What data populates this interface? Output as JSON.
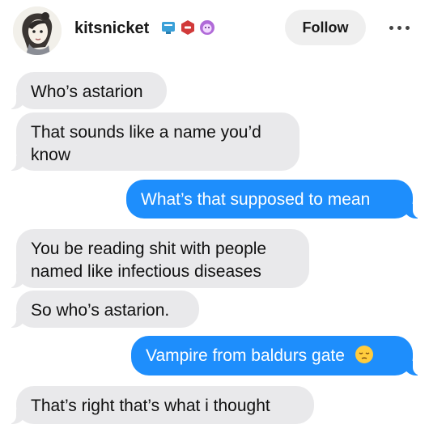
{
  "header": {
    "username": "kitsnicket",
    "follow_label": "Follow",
    "badges": [
      "blue-badge-icon",
      "red-hex-badge-icon",
      "purple-face-badge-icon"
    ]
  },
  "messages": [
    {
      "from": "them",
      "text": "Who’s astarion"
    },
    {
      "from": "them",
      "text": "That sounds like a name you’d know"
    },
    {
      "from": "me",
      "text": "What’s that supposed to mean"
    },
    {
      "from": "them",
      "text": "You be reading shit with people named like infectious diseases"
    },
    {
      "from": "them",
      "text": "So who’s astarion."
    },
    {
      "from": "me",
      "text": "Vampire from baldurs gate",
      "emoji": "pensive-face-emoji"
    },
    {
      "from": "them",
      "text": "That’s right that’s what i thought"
    }
  ],
  "colors": {
    "sent_bubble": "#1e8efc",
    "received_bubble": "#e9e9eb",
    "follow_button": "#efefef"
  }
}
